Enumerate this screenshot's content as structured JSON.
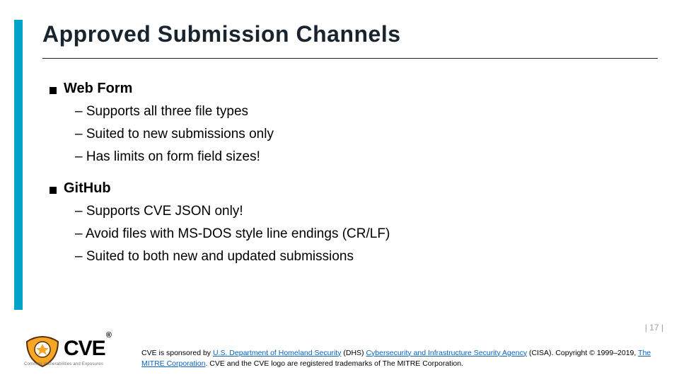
{
  "title": "Approved Submission Channels",
  "bullets": {
    "a": {
      "heading": "Web Form",
      "items": [
        "Supports all three file types",
        "Suited to new submissions only",
        "Has limits on form field sizes!"
      ]
    },
    "b": {
      "heading": "GitHub",
      "items": [
        "Supports CVE JSON only!",
        "Avoid files with MS-DOS style line endings (CR/LF)",
        "Suited to both new and updated submissions"
      ]
    }
  },
  "page": {
    "label": "| 17 |"
  },
  "footer": {
    "pre": "CVE is sponsored by ",
    "link1": "U.S. Department of Homeland Security",
    "mid1": " (DHS) ",
    "link2": "Cybersecurity and Infrastructure Security Agency",
    "mid2": " (CISA). Copyright © 1999–2019, ",
    "link3": "The MITRE Corporation",
    "post": ". CVE and the CVE logo are registered trademarks of The MITRE Corporation."
  },
  "logo": {
    "text": "CVE",
    "reg": "®",
    "tagline": "Common Vulnerabilities and Exposures"
  }
}
